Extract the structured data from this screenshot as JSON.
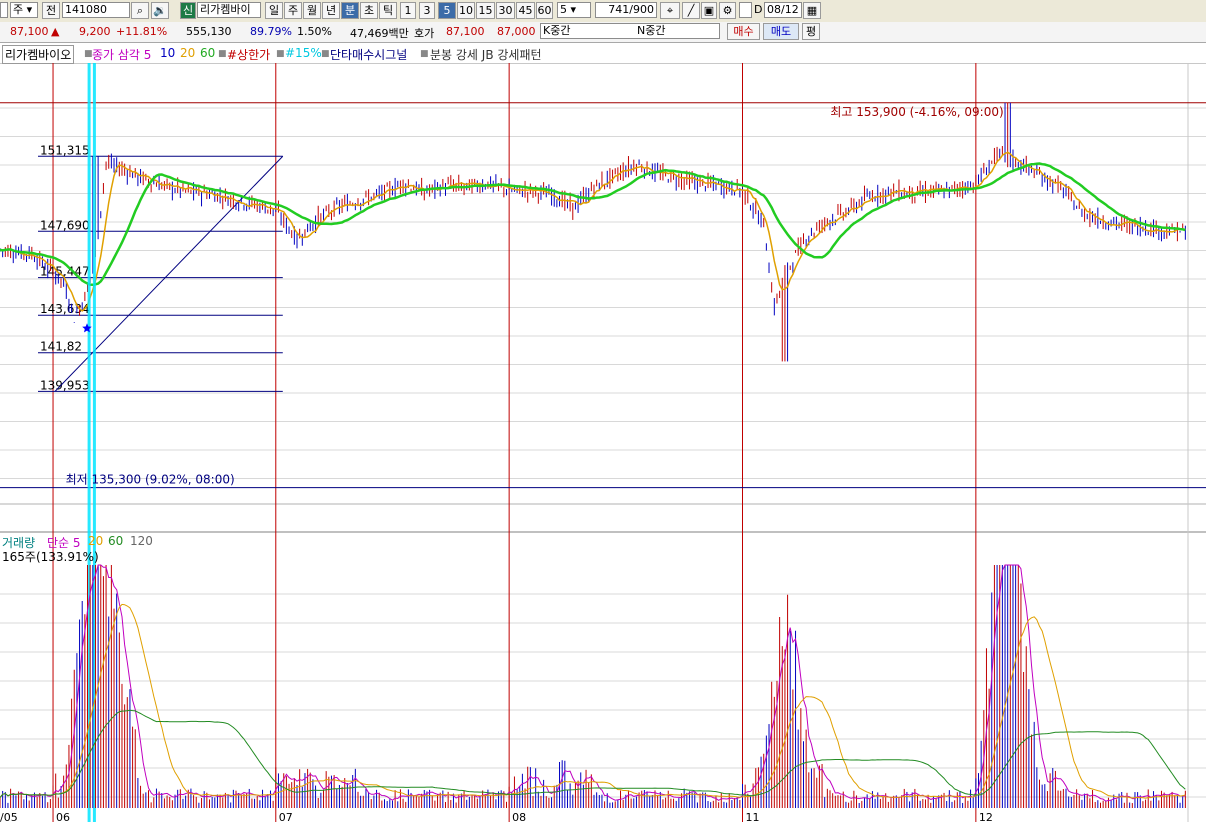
{
  "toolbar": {
    "market": "주",
    "prev": "전",
    "code": "141080",
    "search_icon": "magnifier-icon",
    "speaker_icon": "speaker-icon",
    "credit_badge": "신",
    "stock_name": "리가켐바이",
    "periods": [
      "일",
      "주",
      "월",
      "년",
      "분",
      "초",
      "틱"
    ],
    "selected_period": "분",
    "intervals": [
      "1",
      "3",
      "5",
      "10",
      "15",
      "30",
      "45",
      "60"
    ],
    "selected_interval": "5",
    "count_select": "5",
    "range_display": "741/900",
    "date": "08/12",
    "checkbox_label": "D"
  },
  "info": {
    "price": "87,100",
    "arrow": "▲",
    "change": "9,200",
    "change_pct": "+11.81%",
    "volume": "555,130",
    "volume_ratio": "89.79%",
    "turnover": "1.50%",
    "amount": "47,469백만",
    "quote_label": "호가",
    "ask": "87,100",
    "bid": "87,000",
    "k_label": "K중간",
    "n_label": "N중간",
    "buy": "매수",
    "sell": "매도",
    "avg": "평"
  },
  "legend": {
    "stock": "리가켐바이오",
    "ma": "종가 삼각 5",
    "ma10": "10",
    "ma20": "20",
    "ma60": "60",
    "limit_up": "#상한가",
    "pct15": "#15%",
    "signal": "단타매수시그널",
    "pattern": "분봉 강세 JB 강세패턴"
  },
  "volume_panel": {
    "label": "거래량",
    "ma_label": "단순 5",
    "ma20": "20",
    "ma60": "60",
    "ma120": "120",
    "info": "165주(133.91%)"
  },
  "chart_data": {
    "type": "candlestick",
    "price_axis": {
      "min": 134800,
      "max": 155000
    },
    "fib_levels": [
      "151,315",
      "147,690",
      "145,447",
      "143,634",
      "141,82",
      "139,953"
    ],
    "fib_values": [
      151315,
      147690,
      145447,
      143634,
      141820,
      139953
    ],
    "high_label": "최고 153,900 (-4.16%, 09:00)",
    "high_value": 153900,
    "low_label": "최저 135,300 (9.02%, 08:00)",
    "low_value": 135300,
    "date_labels": [
      "06",
      "07",
      "08",
      "11",
      "12"
    ],
    "first_date_label": "/05",
    "day_starts": [
      5,
      26,
      48,
      70,
      92
    ],
    "total_bars": 112,
    "spikes": [
      [
        9,
        151300
      ],
      [
        95,
        153900
      ],
      [
        74,
        141400
      ]
    ],
    "close_path": [
      [
        0,
        146800
      ],
      [
        3,
        146600
      ],
      [
        5,
        145700
      ],
      [
        6,
        145200
      ],
      [
        7,
        143500
      ],
      [
        8,
        144500
      ],
      [
        9,
        146500
      ],
      [
        10,
        151000
      ],
      [
        12,
        150600
      ],
      [
        14,
        150100
      ],
      [
        16,
        149800
      ],
      [
        18,
        149600
      ],
      [
        20,
        149500
      ],
      [
        22,
        149200
      ],
      [
        24,
        149000
      ],
      [
        26,
        148700
      ],
      [
        28,
        147300
      ],
      [
        30,
        148300
      ],
      [
        32,
        148900
      ],
      [
        34,
        149200
      ],
      [
        36,
        149500
      ],
      [
        38,
        150000
      ],
      [
        40,
        149600
      ],
      [
        42,
        149900
      ],
      [
        44,
        149800
      ],
      [
        46,
        150000
      ],
      [
        48,
        149700
      ],
      [
        50,
        149600
      ],
      [
        52,
        149500
      ],
      [
        54,
        148800
      ],
      [
        56,
        149800
      ],
      [
        58,
        150400
      ],
      [
        60,
        150900
      ],
      [
        62,
        150500
      ],
      [
        64,
        150200
      ],
      [
        66,
        150000
      ],
      [
        68,
        149900
      ],
      [
        70,
        149700
      ],
      [
        72,
        148000
      ],
      [
        73,
        144000
      ],
      [
        74,
        145600
      ],
      [
        76,
        147400
      ],
      [
        78,
        148200
      ],
      [
        80,
        148700
      ],
      [
        82,
        149400
      ],
      [
        84,
        149600
      ],
      [
        86,
        149500
      ],
      [
        88,
        149600
      ],
      [
        90,
        149700
      ],
      [
        92,
        150000
      ],
      [
        94,
        151400
      ],
      [
        96,
        151000
      ],
      [
        98,
        150400
      ],
      [
        100,
        149800
      ],
      [
        102,
        148600
      ],
      [
        104,
        148200
      ],
      [
        106,
        148000
      ],
      [
        108,
        147900
      ],
      [
        110,
        147700
      ],
      [
        112,
        147700
      ]
    ],
    "volume_peaks": [
      [
        9,
        1.0
      ],
      [
        10,
        0.55
      ],
      [
        11,
        0.4
      ],
      [
        74,
        0.45
      ],
      [
        95,
        1.0
      ],
      [
        96,
        0.3
      ]
    ]
  },
  "colors": {
    "grid": "#d8d8d8",
    "day_line": "#c00000",
    "ma5": "#e0a000",
    "ma20": "#22cc22",
    "ma60_vol": "#228b22",
    "candle_up": "#c00000",
    "candle_down": "#0000c0",
    "fib": "#000080",
    "signal": "#00e5ff"
  }
}
